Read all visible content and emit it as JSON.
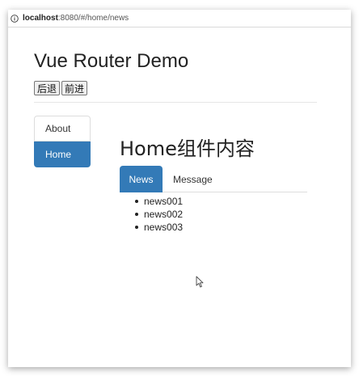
{
  "browser": {
    "url_host": "localhost",
    "url_path": ":8080/#/home/news"
  },
  "app": {
    "title": "Vue Router Demo",
    "back_label": "后退",
    "forward_label": "前进"
  },
  "sidebar": {
    "items": [
      {
        "label": "About",
        "active": false
      },
      {
        "label": "Home",
        "active": true
      }
    ]
  },
  "home": {
    "title": "Home组件内容",
    "tabs": [
      {
        "label": "News",
        "active": true
      },
      {
        "label": "Message",
        "active": false
      }
    ],
    "news": [
      "news001",
      "news002",
      "news003"
    ]
  },
  "colors": {
    "accent": "#337ab7"
  }
}
